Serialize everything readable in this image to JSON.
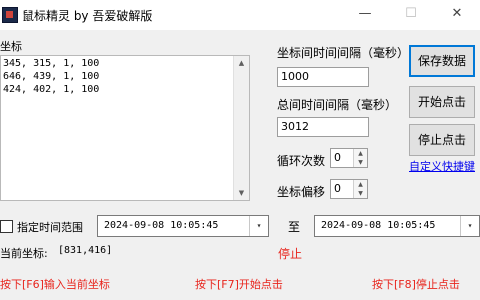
{
  "window": {
    "title": "鼠标精灵 by 吾爱破解版",
    "controls": {
      "minimize": "—",
      "maximize": "☐",
      "close": "✕"
    }
  },
  "coords": {
    "group_label": "坐标",
    "lines": [
      "345, 315, 1, 100",
      "646, 439, 1, 100",
      "424, 402, 1, 100"
    ]
  },
  "settings": {
    "coord_interval_label": "坐标间时间间隔（毫秒）",
    "coord_interval_value": "1000",
    "total_interval_label": "总间时间间隔（毫秒）",
    "total_interval_value": "3012",
    "loop_count_label": "循环次数",
    "loop_count_value": "0",
    "coord_offset_label": "坐标偏移",
    "coord_offset_value": "0"
  },
  "buttons": {
    "save": "保存数据",
    "start": "开始点击",
    "stop": "停止点击",
    "custom_hotkey": "自定义快捷键"
  },
  "time_range": {
    "checkbox_label": "指定时间范围",
    "checked": false,
    "start": "2024-09-08  10:05:45",
    "to_label": "至",
    "end": "2024-09-08  10:05:45"
  },
  "status": {
    "current_coord_label": "当前坐标:",
    "current_coord_value": "[831,416]",
    "state": "停止"
  },
  "hints": {
    "f6": "按下[F6]输入当前坐标",
    "f7": "按下[F7]开始点击",
    "f8": "按下[F8]停止点击"
  },
  "colors": {
    "accent_red": "#e8251d",
    "link_blue": "#0000ee",
    "focus_blue": "#0078d7"
  }
}
